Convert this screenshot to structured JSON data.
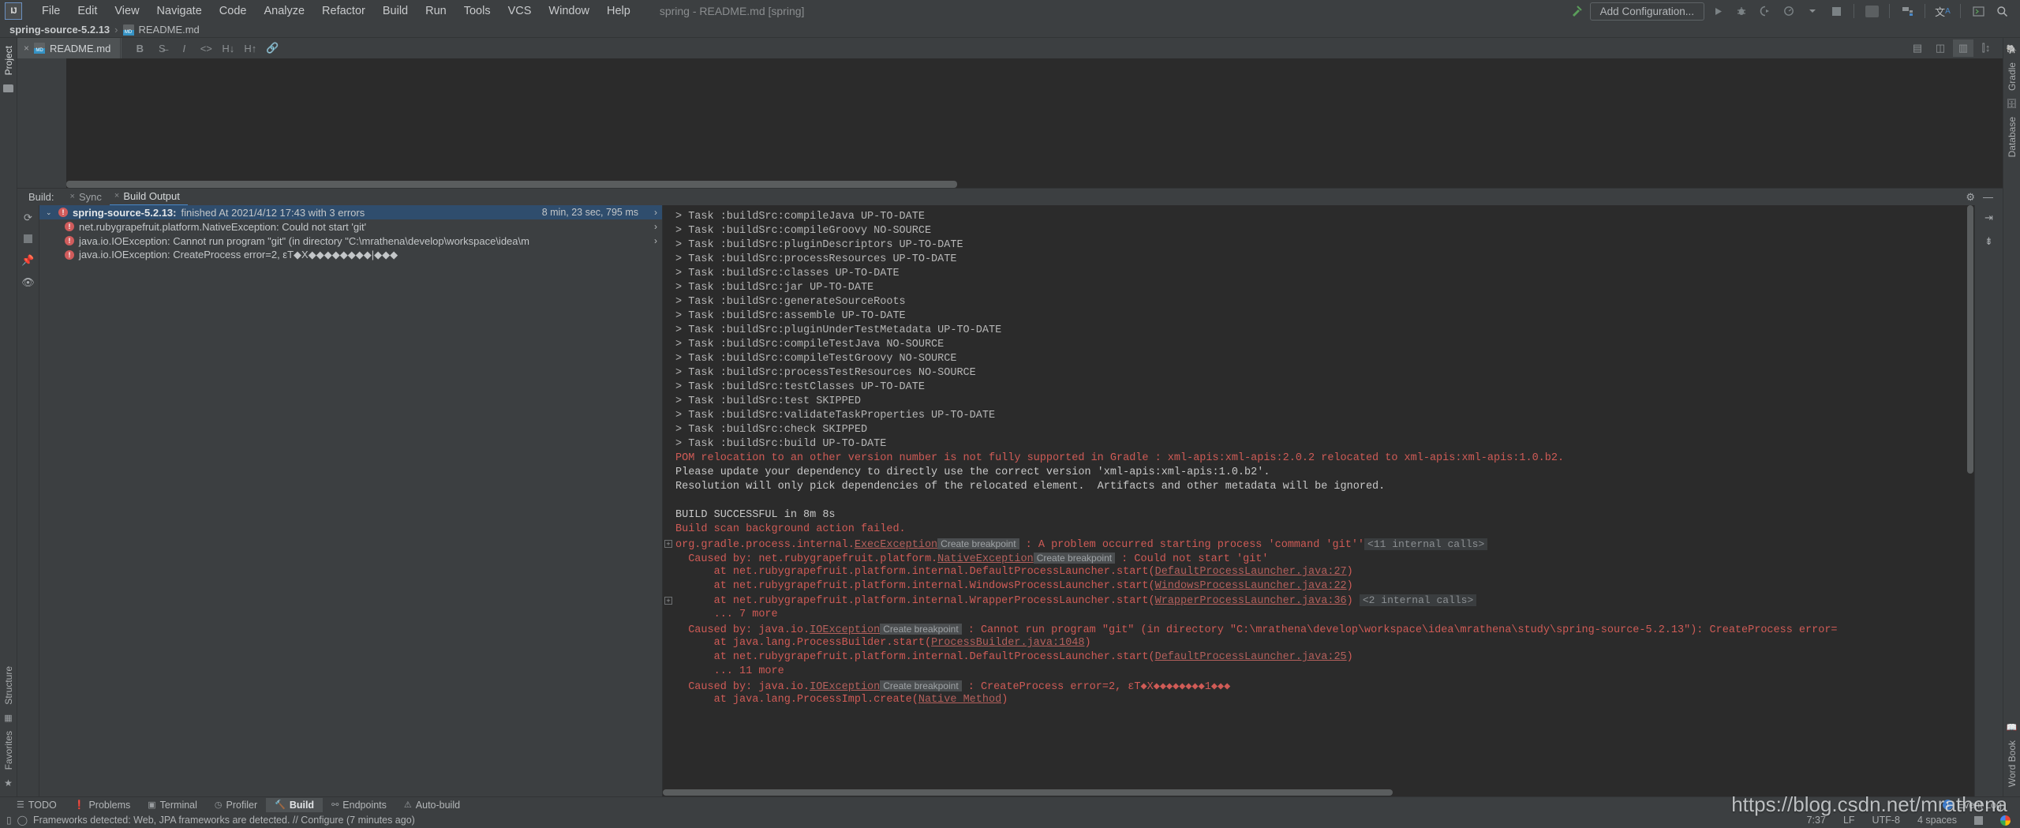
{
  "window": {
    "title": "spring - README.md [spring]",
    "logo": "IJ"
  },
  "menubar": {
    "items": [
      {
        "label": "File"
      },
      {
        "label": "Edit"
      },
      {
        "label": "View"
      },
      {
        "label": "Navigate"
      },
      {
        "label": "Code"
      },
      {
        "label": "Analyze"
      },
      {
        "label": "Refactor"
      },
      {
        "label": "Build"
      },
      {
        "label": "Run"
      },
      {
        "label": "Tools"
      },
      {
        "label": "VCS"
      },
      {
        "label": "Window"
      },
      {
        "label": "Help"
      }
    ]
  },
  "toolbar": {
    "add_configuration": "Add Configuration...",
    "icons": [
      "build-hammer-icon",
      "run-icon",
      "debug-icon",
      "run-coverage-icon",
      "profiler-icon",
      "dropdown-icon",
      "stop-icon",
      "updates-icon",
      "project-structure-icon",
      "translate-icon",
      "terminal-icon",
      "search-everywhere-icon"
    ]
  },
  "breadcrumb": {
    "project": "spring-source-5.2.13",
    "separator": "›",
    "file": "README.md"
  },
  "left_strip": {
    "tabs": [
      {
        "label": "Project",
        "selected": true
      },
      {
        "label": "Structure",
        "selected": false
      },
      {
        "label": "Favorites",
        "selected": false
      }
    ]
  },
  "right_strip": {
    "tabs": [
      {
        "label": "Gradle"
      },
      {
        "label": "Database"
      },
      {
        "label": "Word Book"
      }
    ]
  },
  "editor": {
    "tab": {
      "label": "README.md",
      "close": "×"
    },
    "markdown_toolbar": [
      "bold-icon",
      "strikethrough-icon",
      "italic-icon",
      "code-icon",
      "heading-down-icon",
      "heading-up-icon",
      "link-icon"
    ],
    "view_buttons": [
      "editor-only-icon",
      "editor-preview-icon",
      "preview-only-icon",
      "split-icon"
    ]
  },
  "build_panel": {
    "label": "Build:",
    "tabs": [
      {
        "label": "Sync",
        "selected": false,
        "close": "×"
      },
      {
        "label": "Build Output",
        "selected": true,
        "close": "×"
      }
    ],
    "settings_icon": "gear-icon",
    "minimize_icon": "minimize-icon",
    "actions": [
      "rerun-icon",
      "stop-icon",
      "pin-icon",
      "filter-icon"
    ],
    "side_actions": [
      "soft-wrap-icon",
      "scroll-to-end-icon"
    ],
    "tree": [
      {
        "indent": 0,
        "chevron": "⌄",
        "icon": "error-icon",
        "name": "spring-source-5.2.13:",
        "detail": " finished At 2021/4/12 17:43 with 3 errors",
        "duration": "8 min, 23 sec, 795 ms",
        "arrow": "›",
        "selected": true
      },
      {
        "indent": 1,
        "icon": "error-icon",
        "name": "",
        "detail": "net.rubygrapefruit.platform.NativeException: Could not start 'git'",
        "arrow": "›",
        "selected": false
      },
      {
        "indent": 1,
        "icon": "error-icon",
        "name": "",
        "detail": "java.io.IOException: Cannot run program \"git\" (in directory \"C:\\mrathena\\develop\\workspace\\idea\\m",
        "arrow": "›",
        "selected": false
      },
      {
        "indent": 1,
        "icon": "error-icon",
        "name": "",
        "detail": "java.io.IOException: CreateProcess error=2, εT◆X◆◆◆◆◆◆◆◆|◆◆◆",
        "arrow": "",
        "selected": false
      }
    ],
    "console_lines": [
      {
        "text": "> Task :buildSrc:compileJava UP-TO-DATE",
        "color": "gray"
      },
      {
        "text": "> Task :buildSrc:compileGroovy NO-SOURCE",
        "color": "gray"
      },
      {
        "text": "> Task :buildSrc:pluginDescriptors UP-TO-DATE",
        "color": "gray"
      },
      {
        "text": "> Task :buildSrc:processResources UP-TO-DATE",
        "color": "gray"
      },
      {
        "text": "> Task :buildSrc:classes UP-TO-DATE",
        "color": "gray"
      },
      {
        "text": "> Task :buildSrc:jar UP-TO-DATE",
        "color": "gray"
      },
      {
        "text": "> Task :buildSrc:generateSourceRoots",
        "color": "gray"
      },
      {
        "text": "> Task :buildSrc:assemble UP-TO-DATE",
        "color": "gray"
      },
      {
        "text": "> Task :buildSrc:pluginUnderTestMetadata UP-TO-DATE",
        "color": "gray"
      },
      {
        "text": "> Task :buildSrc:compileTestJava NO-SOURCE",
        "color": "gray"
      },
      {
        "text": "> Task :buildSrc:compileTestGroovy NO-SOURCE",
        "color": "gray"
      },
      {
        "text": "> Task :buildSrc:processTestResources NO-SOURCE",
        "color": "gray"
      },
      {
        "text": "> Task :buildSrc:testClasses UP-TO-DATE",
        "color": "gray"
      },
      {
        "text": "> Task :buildSrc:test SKIPPED",
        "color": "gray"
      },
      {
        "text": "> Task :buildSrc:validateTaskProperties UP-TO-DATE",
        "color": "gray"
      },
      {
        "text": "> Task :buildSrc:check SKIPPED",
        "color": "gray"
      },
      {
        "text": "> Task :buildSrc:build UP-TO-DATE",
        "color": "gray"
      },
      {
        "text": "POM relocation to an other version number is not fully supported in Gradle : xml-apis:xml-apis:2.0.2 relocated to xml-apis:xml-apis:1.0.b2.",
        "color": "red"
      },
      {
        "text": "Please update your dependency to directly use the correct version 'xml-apis:xml-apis:1.0.b2'.",
        "color": "white"
      },
      {
        "text": "Resolution will only pick dependencies of the relocated element.  Artifacts and other metadata will be ignored.",
        "color": "white"
      },
      {
        "text": "",
        "color": "blank"
      },
      {
        "text": "BUILD SUCCESSFUL in 8m 8s",
        "color": "white"
      },
      {
        "text": "Build scan background action failed.",
        "color": "red"
      }
    ],
    "stacktrace": [
      {
        "fold": "+",
        "color": "red",
        "parts": [
          {
            "t": "org.gradle.process.internal.",
            "k": "plain"
          },
          {
            "t": "ExecException",
            "k": "link"
          },
          {
            "t": "Create breakpoint",
            "k": "chip"
          },
          {
            "t": " : A problem occurred starting process 'command 'git''",
            "k": "plain"
          },
          {
            "t": "<11 internal calls>",
            "k": "chipgray"
          }
        ]
      },
      {
        "color": "red",
        "parts": [
          {
            "t": "  Caused by: net.rubygrapefruit.platform.",
            "k": "plain"
          },
          {
            "t": "NativeException",
            "k": "link"
          },
          {
            "t": "Create breakpoint",
            "k": "chip"
          },
          {
            "t": " : Could not start 'git'",
            "k": "plain"
          }
        ]
      },
      {
        "color": "red",
        "parts": [
          {
            "t": "      at net.rubygrapefruit.platform.internal.DefaultProcessLauncher.start(",
            "k": "plain"
          },
          {
            "t": "DefaultProcessLauncher.java:27",
            "k": "link"
          },
          {
            "t": ")",
            "k": "plain"
          }
        ]
      },
      {
        "color": "red",
        "parts": [
          {
            "t": "      at net.rubygrapefruit.platform.internal.WindowsProcessLauncher.start(",
            "k": "plain"
          },
          {
            "t": "WindowsProcessLauncher.java:22",
            "k": "link"
          },
          {
            "t": ")",
            "k": "plain"
          }
        ]
      },
      {
        "fold": "+",
        "color": "red",
        "parts": [
          {
            "t": "      at net.rubygrapefruit.platform.internal.WrapperProcessLauncher.start(",
            "k": "plain"
          },
          {
            "t": "WrapperProcessLauncher.java:36",
            "k": "link"
          },
          {
            "t": ") ",
            "k": "plain"
          },
          {
            "t": "<2 internal calls>",
            "k": "chipgray"
          }
        ]
      },
      {
        "color": "red",
        "parts": [
          {
            "t": "      ... 7 more",
            "k": "plain"
          }
        ]
      },
      {
        "color": "red",
        "parts": [
          {
            "t": "  Caused by: java.io.",
            "k": "plain"
          },
          {
            "t": "IOException",
            "k": "link"
          },
          {
            "t": "Create breakpoint",
            "k": "chip"
          },
          {
            "t": " : Cannot run program \"git\" (in directory \"C:\\mrathena\\develop\\workspace\\idea\\mrathena\\study\\spring-source-5.2.13\"): CreateProcess error=",
            "k": "plain"
          }
        ]
      },
      {
        "color": "red",
        "parts": [
          {
            "t": "      at java.lang.ProcessBuilder.start(",
            "k": "plain"
          },
          {
            "t": "ProcessBuilder.java:1048",
            "k": "link"
          },
          {
            "t": ")",
            "k": "plain"
          }
        ]
      },
      {
        "color": "red",
        "parts": [
          {
            "t": "      at net.rubygrapefruit.platform.internal.DefaultProcessLauncher.start(",
            "k": "plain"
          },
          {
            "t": "DefaultProcessLauncher.java:25",
            "k": "link"
          },
          {
            "t": ")",
            "k": "plain"
          }
        ]
      },
      {
        "color": "red",
        "parts": [
          {
            "t": "      ... 11 more",
            "k": "plain"
          }
        ]
      },
      {
        "color": "red",
        "parts": [
          {
            "t": "  Caused by: java.io.",
            "k": "plain"
          },
          {
            "t": "IOException",
            "k": "link"
          },
          {
            "t": "Create breakpoint",
            "k": "chip"
          },
          {
            "t": " : CreateProcess error=2, εT◆X◆◆◆◆◆◆◆◆1◆◆◆",
            "k": "plain"
          }
        ]
      },
      {
        "color": "red",
        "parts": [
          {
            "t": "      at java.lang.ProcessImpl.create(",
            "k": "plain"
          },
          {
            "t": "Native Method",
            "k": "link"
          },
          {
            "t": ")",
            "k": "plain"
          }
        ]
      }
    ]
  },
  "bottom_toolbar": {
    "buttons": [
      {
        "label": "TODO",
        "icon": "todo-icon",
        "selected": false
      },
      {
        "label": "Problems",
        "icon": "problems-icon",
        "selected": false
      },
      {
        "label": "Terminal",
        "icon": "terminal-icon",
        "selected": false
      },
      {
        "label": "Profiler",
        "icon": "profiler-icon",
        "selected": false
      },
      {
        "label": "Build",
        "icon": "build-hammer-icon",
        "selected": true
      },
      {
        "label": "Endpoints",
        "icon": "endpoints-icon",
        "selected": false
      },
      {
        "label": "Auto-build",
        "icon": "auto-build-icon",
        "selected": false
      }
    ],
    "event_log": {
      "label": "Event Log",
      "count": "1"
    }
  },
  "statusbar": {
    "message": "Frameworks detected: Web, JPA frameworks are detected. // Configure (7 minutes ago)",
    "icons": [
      "memory-icon",
      "sync-spinner-icon"
    ],
    "right": {
      "caret": "7:37",
      "line_separator": "LF",
      "encoding": "UTF-8",
      "indent": "4 spaces",
      "lock_icon": "lock-icon",
      "google_icon": "google-icon"
    }
  },
  "watermark": "https://blog.csdn.net/mrathena",
  "colors": {
    "background": "#3c3f41",
    "console_bg": "#2b2b2b",
    "error_red": "#cf5b56",
    "selection_blue": "#2f4d6d",
    "accent_blue": "#4a88c7",
    "text": "#bbbbbb"
  }
}
